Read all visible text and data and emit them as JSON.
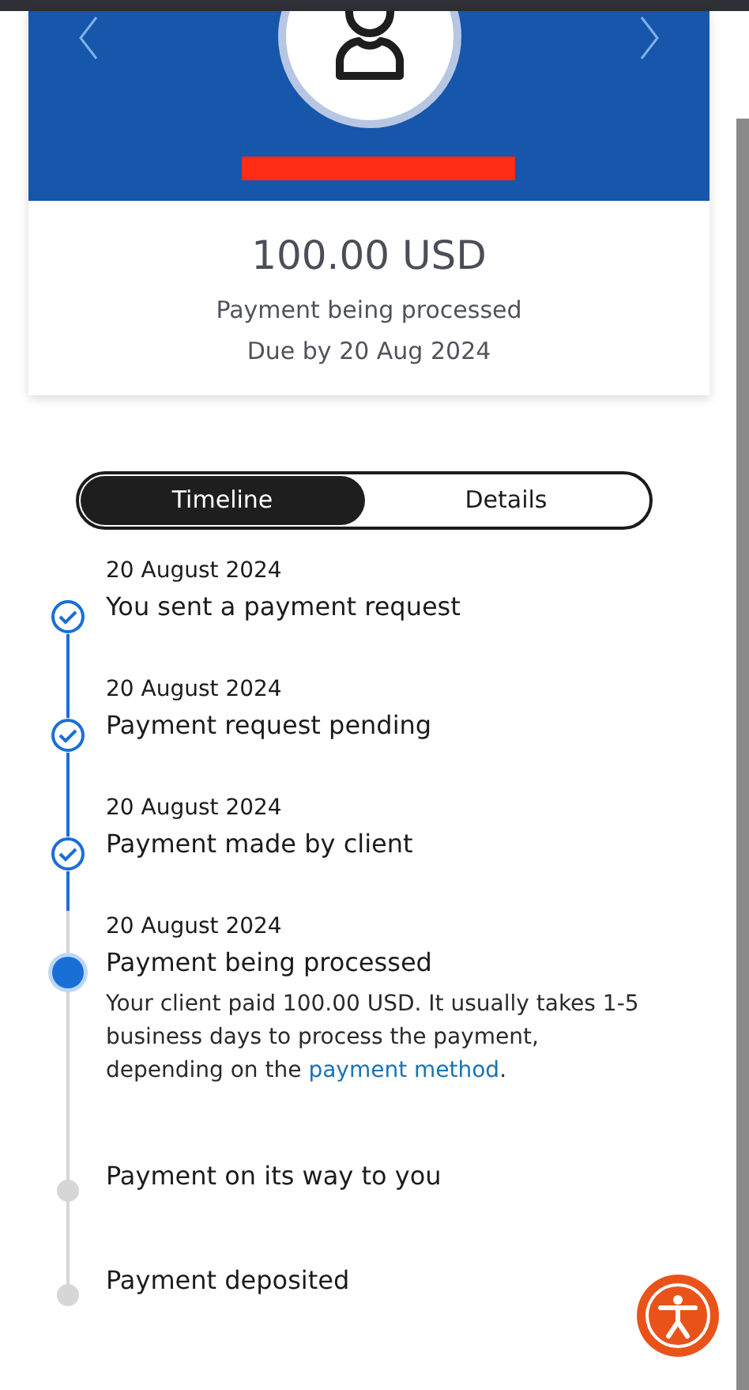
{
  "header": {
    "amount": "100.00 USD",
    "status": "Payment being processed",
    "due": "Due by 20 Aug 2024"
  },
  "tabs": [
    {
      "label": "Timeline",
      "selected": true
    },
    {
      "label": "Details",
      "selected": false
    }
  ],
  "timeline": [
    {
      "kind": "done",
      "date": "20 August 2024",
      "title": "You sent a payment request"
    },
    {
      "kind": "done",
      "date": "20 August 2024",
      "title": "Payment request pending"
    },
    {
      "kind": "done",
      "date": "20 August 2024",
      "title": "Payment made by client"
    },
    {
      "kind": "current",
      "date": "20 August 2024",
      "title": "Payment being processed",
      "description": "Your client paid 100.00 USD. It usually takes 1-5 business days to process the payment, depending on the ",
      "link": "payment method",
      "after": "."
    },
    {
      "kind": "pending",
      "title": "Payment on its way to you"
    },
    {
      "kind": "pending",
      "title": "Payment deposited"
    }
  ]
}
